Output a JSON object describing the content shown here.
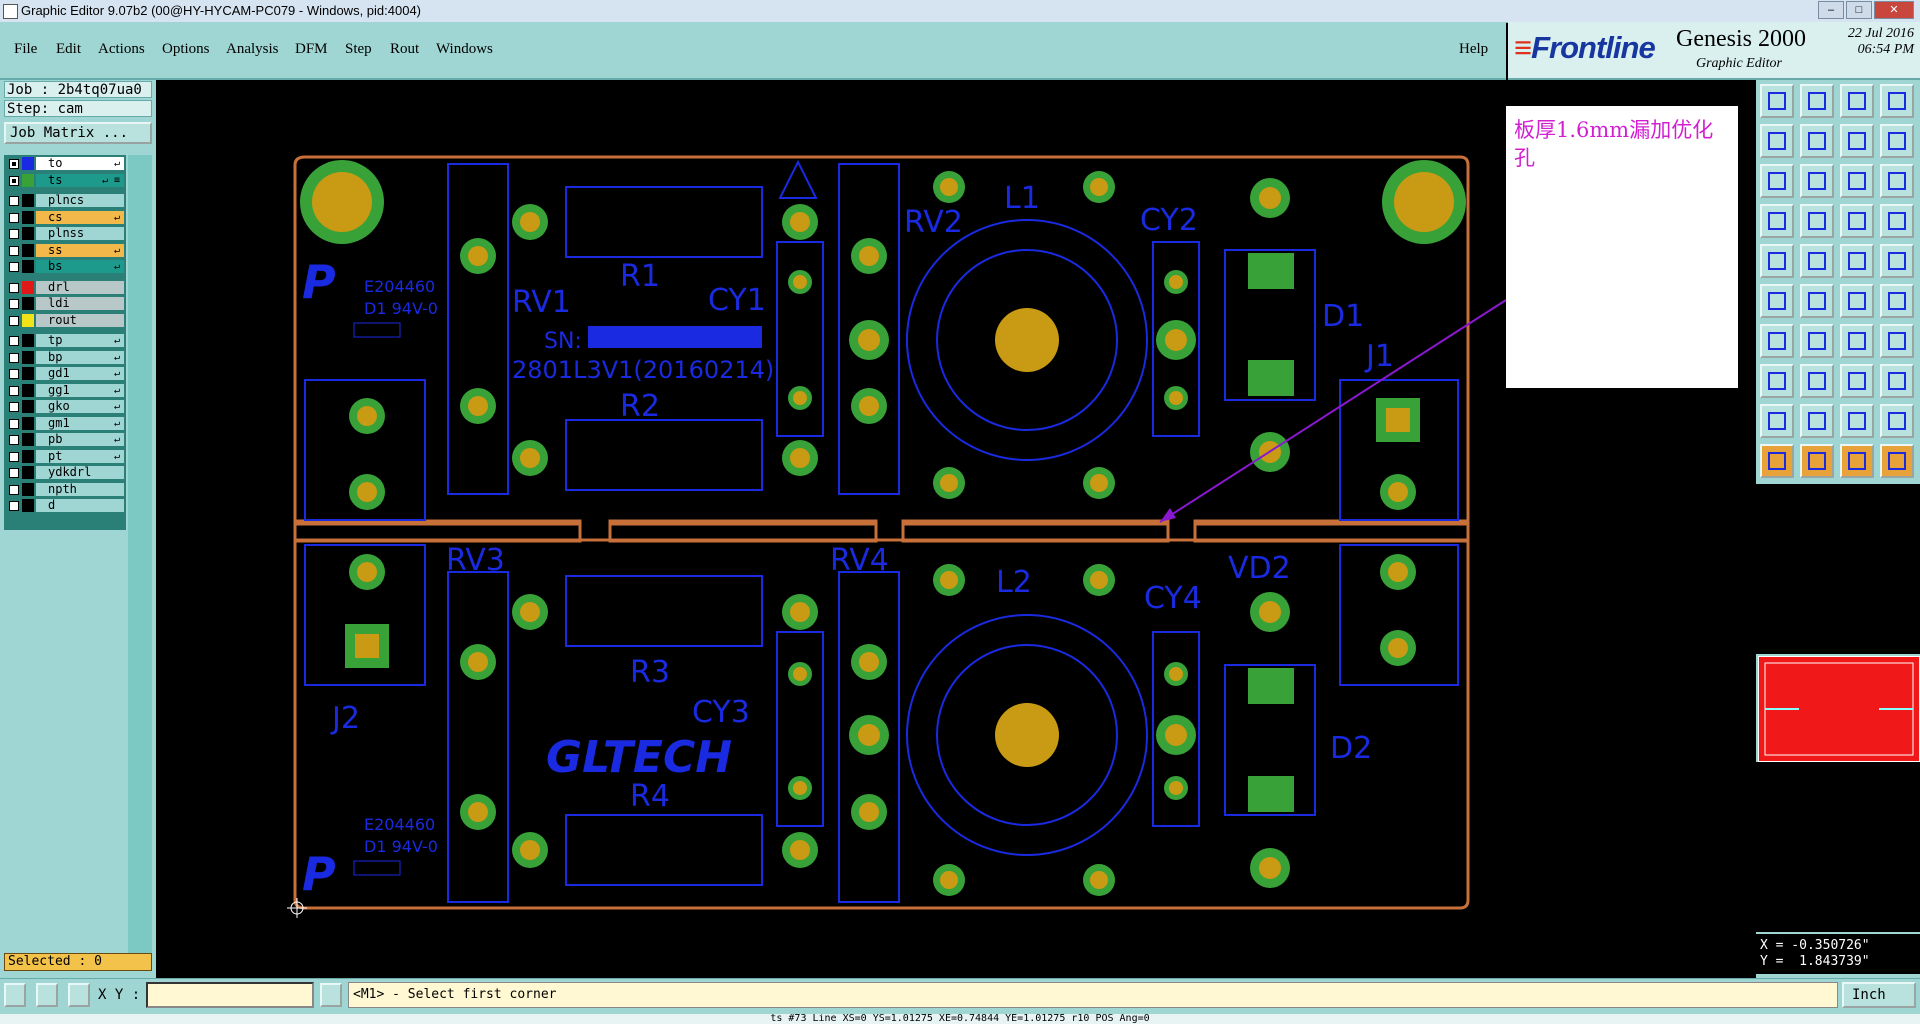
{
  "window": {
    "title": "Graphic Editor 9.07b2 (00@HY-HYCAM-PC079 - Windows, pid:4004)"
  },
  "menu": {
    "items": [
      "File",
      "Edit",
      "Actions",
      "Options",
      "Analysis",
      "DFM",
      "Step",
      "Rout",
      "Windows"
    ],
    "help": "Help"
  },
  "brand": {
    "logo": "Frontline",
    "product": "Genesis 2000",
    "subtitle": "Graphic Editor",
    "date": "22 Jul 2016",
    "time": "06:54 PM"
  },
  "job": {
    "job_line": "Job : 2b4tq07ua0",
    "step_line": "Step: cam",
    "matrix_button": "Job Matrix ..."
  },
  "layers": [
    {
      "name": "to",
      "color": "#1a2ae0",
      "fill": "#ffffff",
      "checked": true,
      "edit": "↵"
    },
    {
      "name": "ts",
      "color": "#38a238",
      "fill": "#1e9a8c",
      "checked": true,
      "edit": "↵ ≡"
    },
    {
      "name": "plncs",
      "color": "#000000",
      "fill": "#9fd5d2",
      "checked": false,
      "edit": ""
    },
    {
      "name": "cs",
      "color": "#000000",
      "fill": "#f2b84a",
      "checked": false,
      "edit": "↵"
    },
    {
      "name": "plnss",
      "color": "#000000",
      "fill": "#9fd5d2",
      "checked": false,
      "edit": ""
    },
    {
      "name": "ss",
      "color": "#000000",
      "fill": "#f2b84a",
      "checked": false,
      "edit": "↵"
    },
    {
      "name": "bs",
      "color": "#000000",
      "fill": "#1e9a8c",
      "checked": false,
      "edit": "↵"
    },
    {
      "name": "drl",
      "color": "#e01818",
      "fill": "#b8c8c8",
      "checked": false,
      "edit": ""
    },
    {
      "name": "ldi",
      "color": "#000000",
      "fill": "#b8c8c8",
      "checked": false,
      "edit": ""
    },
    {
      "name": "rout",
      "color": "#f2e218",
      "fill": "#b8c8c8",
      "checked": false,
      "edit": ""
    },
    {
      "name": "tp",
      "color": "#000000",
      "fill": "#9fd5d2",
      "checked": false,
      "edit": "↵"
    },
    {
      "name": "bp",
      "color": "#000000",
      "fill": "#9fd5d2",
      "checked": false,
      "edit": "↵"
    },
    {
      "name": "gd1",
      "color": "#000000",
      "fill": "#9fd5d2",
      "checked": false,
      "edit": "↵"
    },
    {
      "name": "gg1",
      "color": "#000000",
      "fill": "#9fd5d2",
      "checked": false,
      "edit": "↵"
    },
    {
      "name": "gko",
      "color": "#000000",
      "fill": "#9fd5d2",
      "checked": false,
      "edit": "↵"
    },
    {
      "name": "gm1",
      "color": "#000000",
      "fill": "#9fd5d2",
      "checked": false,
      "edit": "↵"
    },
    {
      "name": "pb",
      "color": "#000000",
      "fill": "#9fd5d2",
      "checked": false,
      "edit": "↵"
    },
    {
      "name": "pt",
      "color": "#000000",
      "fill": "#9fd5d2",
      "checked": false,
      "edit": "↵"
    },
    {
      "name": "ydkdrl",
      "color": "#000000",
      "fill": "#9fd5d2",
      "checked": false,
      "edit": ""
    },
    {
      "name": "npth",
      "color": "#000000",
      "fill": "#9fd5d2",
      "checked": false,
      "edit": ""
    },
    {
      "name": "d",
      "color": "#000000",
      "fill": "#9fd5d2",
      "checked": false,
      "edit": ""
    }
  ],
  "selected": "Selected : 0",
  "board": {
    "refdes": [
      "RV1",
      "R1",
      "CY1",
      "RV2",
      "L1",
      "CY2",
      "D1",
      "J1",
      "R2",
      "RV3",
      "RV4",
      "L2",
      "CY4",
      "VD2",
      "R3",
      "CY3",
      "J2",
      "R4",
      "D2"
    ],
    "marking1": "E204460",
    "marking2": "D1  94V-0",
    "marking3": "E204460",
    "marking4": "D1  94V-0",
    "sn_label": "SN:",
    "part_no": "2801L3V1(20160214)",
    "logo_text": "GLTECH"
  },
  "note": "板厚1.6mm漏加优化孔",
  "coords": {
    "x": "X = -0.350726\"",
    "y": "Y =  1.843739\""
  },
  "status": {
    "xy_label": "X Y :",
    "xy_value": "",
    "prompt": "<M1> - Select first corner",
    "unit": "Inch"
  },
  "bottom_line": "ts #73 Line XS=0 YS=1.01275 XE=0.74844 YE=1.01275 r10 POS Ang=0"
}
